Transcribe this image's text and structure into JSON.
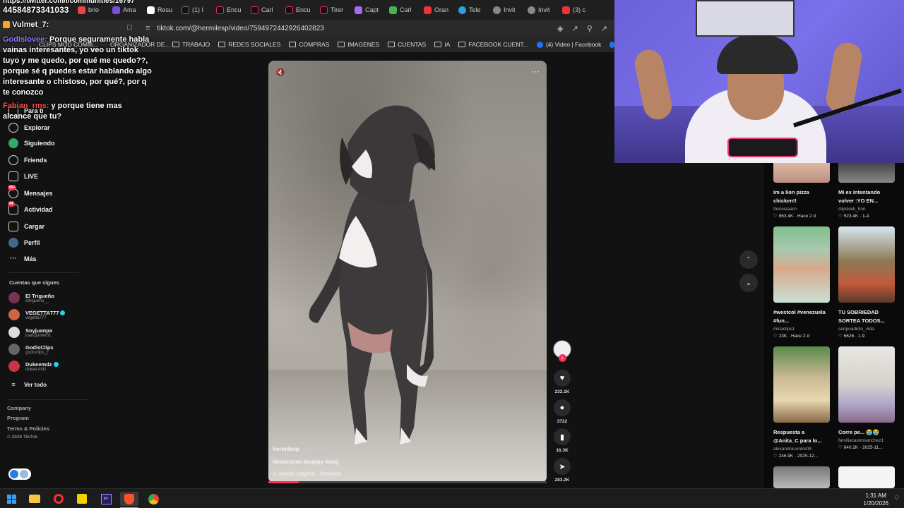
{
  "browser": {
    "tabs": [
      "brio",
      "Ama",
      "Resu",
      "(1) I",
      "Encu",
      "Carl",
      "Encu",
      "Tirer",
      "Capt",
      "Carl",
      "Oran",
      "Tele",
      "Invit",
      "Invit",
      "(3) c"
    ],
    "url": "tiktok.com/@hermilesp/video/7594972442926402823",
    "bookmarks": [
      "TRABAJO",
      "REDES SOCIALES",
      "COMPRAS",
      "IMAGENES",
      "CUENTAS",
      "IA",
      "FACEBOOK CUENT...",
      "(4) Video | Facebook"
    ],
    "bookmarks_partial": [
      "CLIPS MOD COMM...",
      "ORGANIZADOR DE..."
    ]
  },
  "stream_overlay": {
    "top_text": "https://twitter.com/i/communities/16797",
    "number": "44584873341033",
    "streamer_tag": "Vulmet_7:",
    "chat": [
      {
        "user": "Godislovee:",
        "text": "Porque seguramente habla vainas interesantes, yo veo un tiktok tuyo y me quedo, por qué me quedo??, porque sé q puedes estar hablando algo interesante o chistoso, por qué?, por q te conozco"
      },
      {
        "user": "Fabian_rms:",
        "text": "y porque tiene mas alcance que tu?"
      }
    ]
  },
  "sidebar": {
    "items": [
      {
        "label": "Para ti"
      },
      {
        "label": "Explorar"
      },
      {
        "label": "Siguiendo"
      },
      {
        "label": "Friends"
      },
      {
        "label": "LIVE"
      },
      {
        "label": "Mensajes",
        "badge": "99+"
      },
      {
        "label": "Actividad",
        "badge": "44"
      },
      {
        "label": "Cargar"
      },
      {
        "label": "Perfil"
      },
      {
        "label": "Más"
      }
    ],
    "following_title": "Cuentas que sigues",
    "accounts": [
      {
        "name": "El Trigueño",
        "handle": "eltrigueno__",
        "verified": false
      },
      {
        "name": "VEGETTA777",
        "handle": "vegetta777",
        "verified": true
      },
      {
        "name": "Soyjuanpa",
        "handle": "juanquinter01",
        "verified": false
      },
      {
        "name": "GodisClips",
        "handle": "godisclips_c",
        "verified": false
      },
      {
        "name": "Dukeemdz",
        "handle": "dukee.mdz",
        "verified": true
      }
    ],
    "see_all": "Ver todo",
    "footer": [
      "Company",
      "Program",
      "Terms & Policies",
      "© 2026 TikTok"
    ]
  },
  "video": {
    "author": "hermilesp",
    "time": "· Hace 6 d",
    "hashtags": "#mascotas #puppy #dog",
    "sound": "sonido original - hermiles",
    "progress": 0.11,
    "likes": "232.1K",
    "comments": "3722",
    "saves": "16.3K",
    "shares": "283.2K"
  },
  "recommended": [
    {
      "title": "Im a lion pizza chicken!!",
      "author": "theresiaacn",
      "views": "963.4K",
      "date": "Hace 2 d"
    },
    {
      "title": "Mi ex intentando volver :YO EN...",
      "author": "clipskick_hnn",
      "views": "523.4K",
      "date": "1-4"
    },
    {
      "title": "#westcol #venezuela #fun...",
      "author": "micaclips1",
      "views": "23K",
      "date": "Hace 2 d"
    },
    {
      "title": "TU SOBRIEDAD SORTEA TODOS...",
      "author": "sergioadicto_vida",
      "views": "6626",
      "date": "1-9"
    },
    {
      "title": "Respuesta a @Anita_C para lo...",
      "author": "alexandracontre08",
      "views": "246.9K",
      "date": "2025-12..."
    },
    {
      "title": "Corre pe... 😭😭",
      "author": "familiacastrosanchez1",
      "views": "640.2K",
      "date": "2025-11..."
    }
  ],
  "taskbar": {
    "time": "1:31 AM",
    "date": "1/20/2026"
  },
  "colors": {
    "accent": "#fe2c55",
    "verified": "#20d5ec",
    "chat_user": "#9d7bff"
  }
}
